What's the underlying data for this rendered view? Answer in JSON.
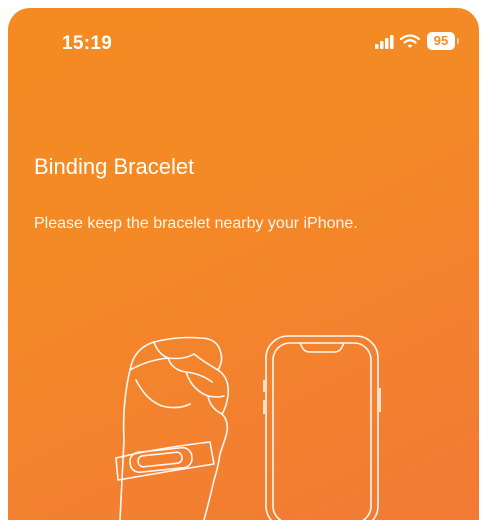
{
  "status_bar": {
    "time": "15:19",
    "battery": "95",
    "icons": [
      "signal-icon",
      "wifi-icon",
      "battery-icon"
    ]
  },
  "header": {
    "title": "Binding Bracelet",
    "subtitle": "Please keep the bracelet nearby your iPhone."
  },
  "illustration": {
    "items": [
      "bracelet-hand-icon",
      "iphone-icon"
    ]
  },
  "colors": {
    "background_start": "#f58a22",
    "background_end": "#f27a35",
    "text": "#ffffff"
  }
}
